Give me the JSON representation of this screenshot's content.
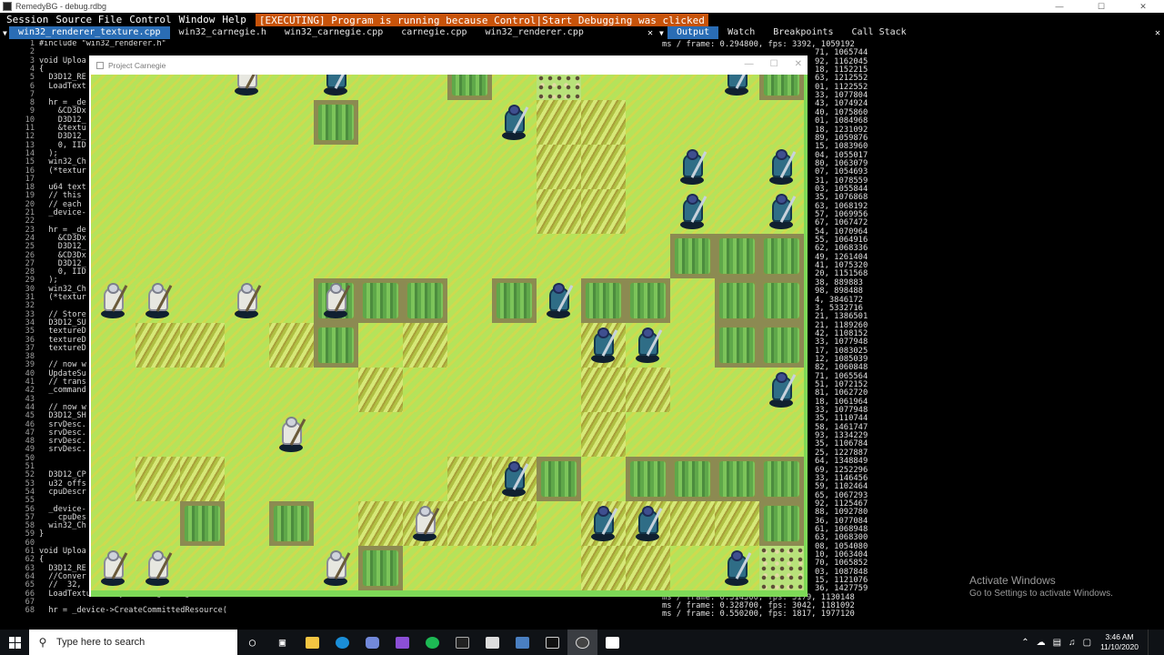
{
  "window": {
    "title": "RemedyBG - debug.rdbg"
  },
  "menu": {
    "items": [
      "Session",
      "Source File",
      "Control",
      "Window",
      "Help"
    ],
    "status": "[EXECUTING] Program is running because Control|Start Debugging was clicked"
  },
  "editor_tabs": [
    "win32_renderer_texture.cpp",
    "win32_carnegie.h",
    "win32_carnegie.cpp",
    "carnegie.cpp",
    "win32_renderer.cpp"
  ],
  "code": [
    {
      "ln": "1",
      "text": "#include \"win32_renderer.h\""
    },
    {
      "ln": "2",
      "text": ""
    },
    {
      "ln": "3",
      "text": "void Uploa"
    },
    {
      "ln": "4",
      "text": "{"
    },
    {
      "ln": "5",
      "text": "  D3D12_RE"
    },
    {
      "ln": "6",
      "text": "  LoadText"
    },
    {
      "ln": "7",
      "text": ""
    },
    {
      "ln": "8",
      "text": "  hr = _de"
    },
    {
      "ln": "9",
      "text": "    &CD3Dx"
    },
    {
      "ln": "10",
      "text": "    D3D12_"
    },
    {
      "ln": "11",
      "text": "    &textu"
    },
    {
      "ln": "12",
      "text": "    D3D12_"
    },
    {
      "ln": "13",
      "text": "    0, IID"
    },
    {
      "ln": "14",
      "text": "  );"
    },
    {
      "ln": "15",
      "text": "  win32_Ch"
    },
    {
      "ln": "16",
      "text": "  (*textur"
    },
    {
      "ln": "17",
      "text": ""
    },
    {
      "ln": "18",
      "text": "  u64 text"
    },
    {
      "ln": "19",
      "text": "  // this"
    },
    {
      "ln": "20",
      "text": "  // each"
    },
    {
      "ln": "21",
      "text": "  _device-"
    },
    {
      "ln": "22",
      "text": ""
    },
    {
      "ln": "23",
      "text": "  hr = _de"
    },
    {
      "ln": "24",
      "text": "    &CD3Dx"
    },
    {
      "ln": "25",
      "text": "    D3D12_"
    },
    {
      "ln": "26",
      "text": "    &CD3Dx"
    },
    {
      "ln": "27",
      "text": "    D3D12_"
    },
    {
      "ln": "28",
      "text": "    0, IID"
    },
    {
      "ln": "29",
      "text": "  );"
    },
    {
      "ln": "30",
      "text": "  win32_Ch"
    },
    {
      "ln": "31",
      "text": "  (*textur"
    },
    {
      "ln": "32",
      "text": ""
    },
    {
      "ln": "33",
      "text": "  // Store"
    },
    {
      "ln": "34",
      "text": "  D3D12_SU"
    },
    {
      "ln": "35",
      "text": "  textureD"
    },
    {
      "ln": "36",
      "text": "  textureD"
    },
    {
      "ln": "37",
      "text": "  textureD"
    },
    {
      "ln": "38",
      "text": ""
    },
    {
      "ln": "39",
      "text": "  // now w"
    },
    {
      "ln": "40",
      "text": "  UpdateSu"
    },
    {
      "ln": "41",
      "text": "  // trans"
    },
    {
      "ln": "42",
      "text": "  _command"
    },
    {
      "ln": "43",
      "text": ""
    },
    {
      "ln": "44",
      "text": "  // now w"
    },
    {
      "ln": "45",
      "text": "  D3D12_SH"
    },
    {
      "ln": "46",
      "text": "  srvDesc."
    },
    {
      "ln": "47",
      "text": "  srvDesc."
    },
    {
      "ln": "48",
      "text": "  srvDesc."
    },
    {
      "ln": "49",
      "text": "  srvDesc."
    },
    {
      "ln": "50",
      "text": ""
    },
    {
      "ln": "51",
      "text": ""
    },
    {
      "ln": "52",
      "text": "  D3D12_CP"
    },
    {
      "ln": "53",
      "text": "  u32 offs"
    },
    {
      "ln": "54",
      "text": "  cpuDescr"
    },
    {
      "ln": "55",
      "text": ""
    },
    {
      "ln": "56",
      "text": "  _device-"
    },
    {
      "ln": "57",
      "text": "    cpuDes"
    },
    {
      "ln": "58",
      "text": "  win32_Ch"
    },
    {
      "ln": "59",
      "text": "}"
    },
    {
      "ln": "60",
      "text": ""
    },
    {
      "ln": "61",
      "text": "void Uploa"
    },
    {
      "ln": "62",
      "text": "{"
    },
    {
      "ln": "63",
      "text": "  D3D12_RE"
    },
    {
      "ln": "64",
      "text": "  //Conver"
    },
    {
      "ln": "65",
      "text": "  //  32,"
    },
    {
      "ln": "66",
      "text": "  LoadTextureArrayFromImage(imageData, &textureDesc);"
    },
    {
      "ln": "67",
      "text": ""
    },
    {
      "ln": "68",
      "text": "  hr = _device->CreateCommittedResource("
    }
  ],
  "output_tabs": [
    "Output",
    "Watch",
    "Breakpoints",
    "Call Stack"
  ],
  "output_lines": [
    "ms / frame: 0.294800, fps: 3392, 1059192",
    "71, 1065744",
    "92, 1162045",
    "18, 1152215",
    "63, 1212552",
    "01, 1122552",
    "33, 1077804",
    "43, 1074924",
    "40, 1075860",
    "01, 1084968",
    "18, 1231092",
    "89, 1059876",
    "15, 1083960",
    "04, 1055017",
    "80, 1063079",
    "07, 1054693",
    "31, 1078559",
    "03, 1055844",
    "35, 1076868",
    "63, 1068192",
    "57, 1069956",
    "67, 1067472",
    "54, 1070964",
    "55, 1064916",
    "62, 1068336",
    "49, 1261404",
    "41, 1075320",
    "20, 1151568",
    "38, 889883",
    "98, 898488",
    "4, 3846172",
    "3, 5332716",
    "21, 1386501",
    "21, 1189260",
    "42, 1108152",
    "33, 1077948",
    "17, 1083025",
    "12, 1085039",
    "82, 1060848",
    "71, 1065564",
    "51, 1072152",
    "81, 1062720",
    "18, 1061964",
    "33, 1077948",
    "35, 1110744",
    "58, 1461747",
    "93, 1334229",
    "35, 1106784",
    "25, 1227887",
    "64, 1348849",
    "69, 1252296",
    "33, 1146456",
    "59, 1102464",
    "65, 1067293",
    "92, 1125467",
    "88, 1092780",
    "36, 1077084",
    "61, 1068948",
    "63, 1068300",
    "08, 1054080",
    "10, 1063404",
    "70, 1065852",
    "03, 1087848",
    "15, 1121076",
    "36, 1427759",
    "ms / frame: 0.314500, fps: 3179, 1130148",
    "ms / frame: 0.328700, fps: 3042, 1181092",
    "ms / frame: 0.550200, fps: 1817, 1977120"
  ],
  "watermark": {
    "title": "Activate Windows",
    "sub": "Go to Settings to activate Windows."
  },
  "game_window": {
    "title": "Project Carnegie"
  },
  "board": {
    "rows": [
      "ppppppppppppppp",
      "pppppppppppppppp",
      "pppppppppppppppp",
      "pppppppppppppppp",
      "pppppppppppppppp",
      "pppppppppppppppp",
      "pppppppppppppppp",
      "pppppppppppppppp",
      "pppppppppppppppp",
      "pppppppppppppppp",
      "pppppppppppppppp",
      "pppppppppppppppp"
    ]
  },
  "taskbar": {
    "search_placeholder": "Type here to search",
    "time": "3:46 AM",
    "date": "11/10/2020"
  }
}
